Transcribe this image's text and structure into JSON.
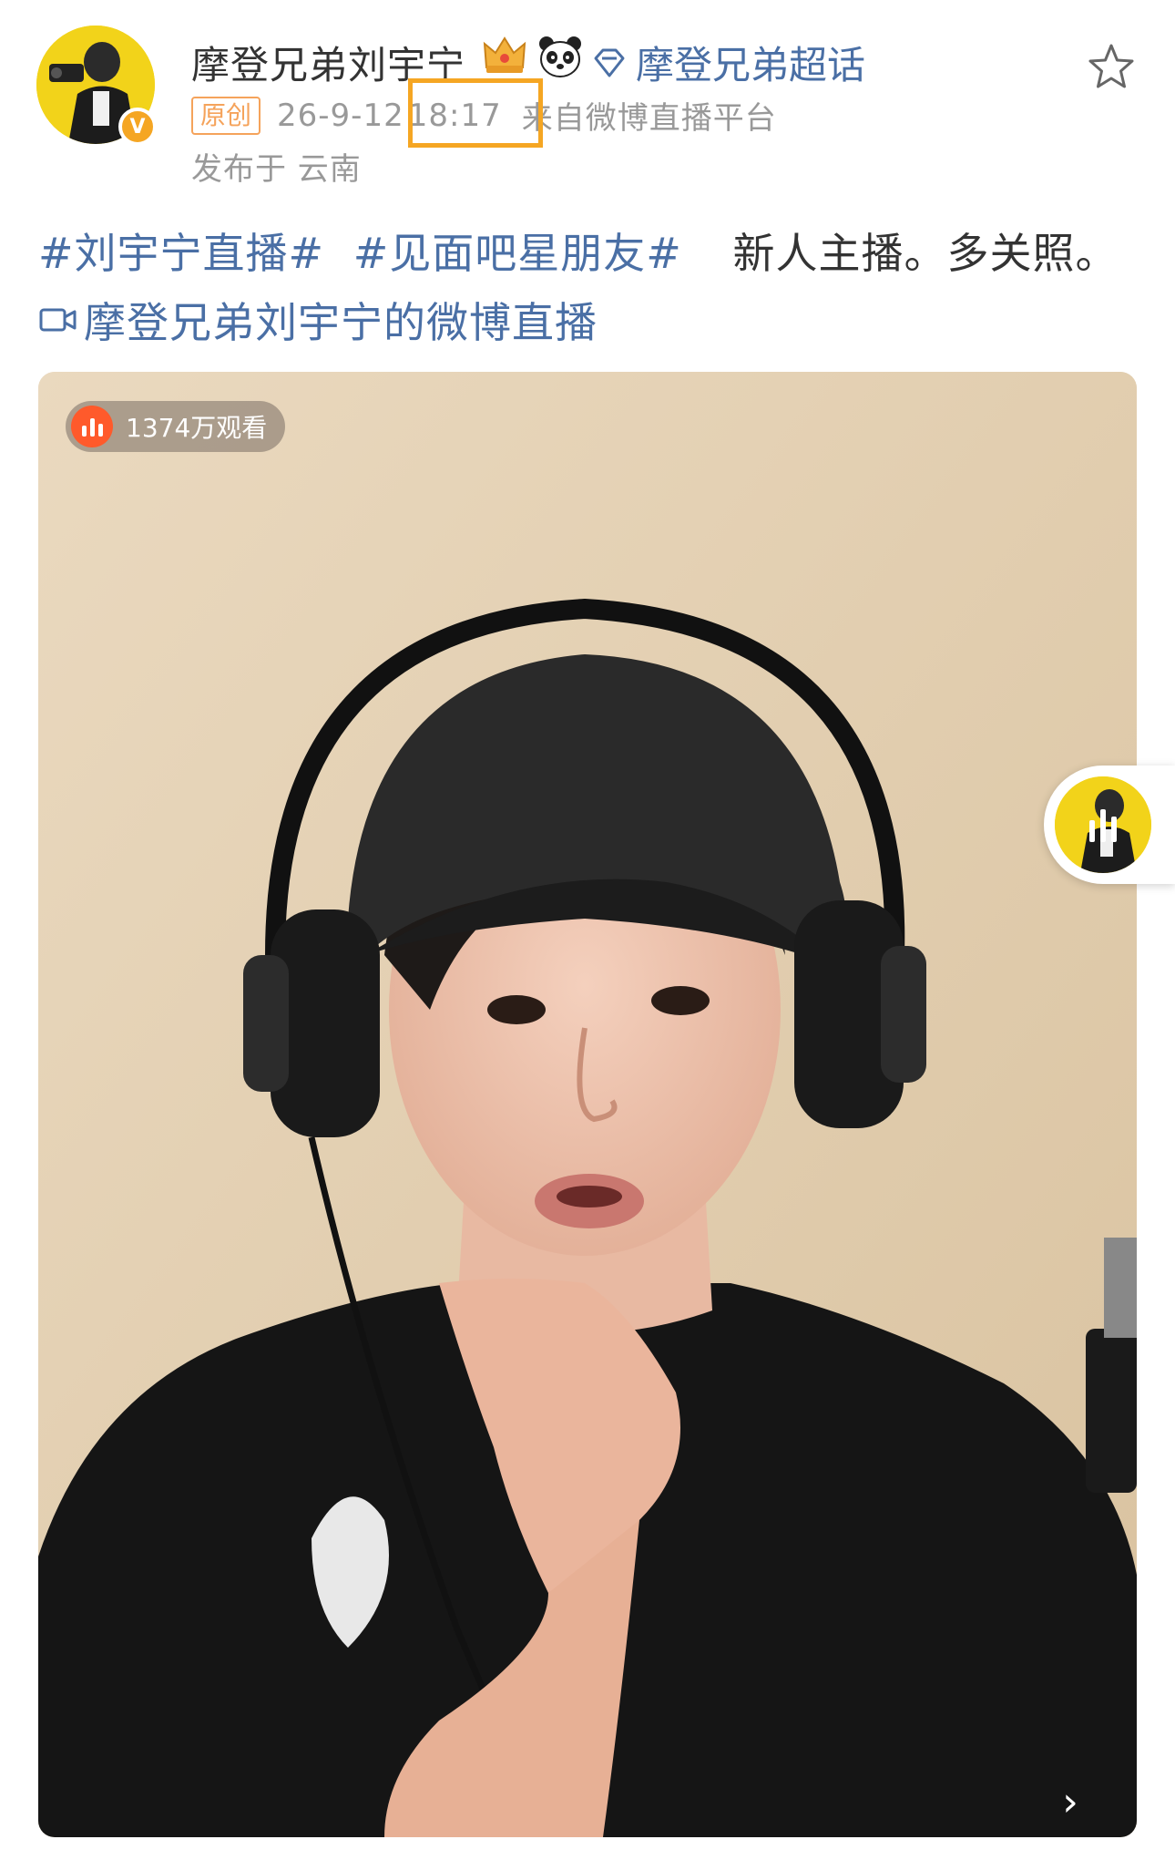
{
  "post": {
    "username": "摩登兄弟刘宇宁",
    "supertopic_label": "摩登兄弟超话",
    "original_badge": "原创",
    "date": "26-9-12",
    "time": "18:17",
    "source": "来自微博直播平台",
    "location": "发布于 云南",
    "hashtag_1": "#刘宇宁直播#",
    "hashtag_2": "#见面吧星朋友#",
    "body_text": "新人主播。多关照。",
    "live_link_label": "摩登兄弟刘宇宁的微博直播"
  },
  "video": {
    "view_count": "1374万观看",
    "next_label": "›"
  },
  "icons": {
    "verified": "verified-v-icon",
    "crown": "crown-badge-icon",
    "panda": "panda-icon",
    "diamond": "diamond-supertopic-icon",
    "star": "favorite-star-icon",
    "camera": "live-camera-icon"
  },
  "colors": {
    "link_blue": "#4a6fa5",
    "highlight_orange": "#f5a623",
    "live_red": "#ff5a2b",
    "meta_gray": "#999999"
  }
}
